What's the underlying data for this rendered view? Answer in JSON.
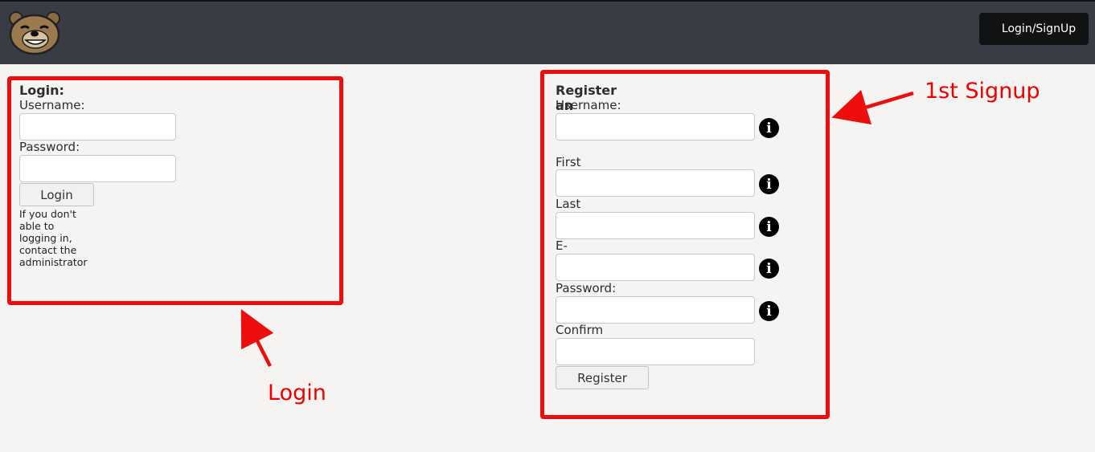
{
  "header": {
    "logo_icon": "bear-face-icon",
    "nav_button_label": "Login/SignUp"
  },
  "login": {
    "title": "Login:",
    "username_label": "Username:",
    "username_value": "",
    "password_label": "Password:",
    "password_value": "",
    "submit_label": "Login",
    "note": "If you don't able to logging in, contact the administrator"
  },
  "register": {
    "title": "Register an Account:",
    "fields": [
      {
        "label": "Username:",
        "value": "",
        "info_icon": "info-icon"
      },
      {
        "label": "First name(s):",
        "value": "",
        "info_icon": "info-icon"
      },
      {
        "label": "Last name(s):",
        "value": "",
        "info_icon": "info-icon"
      },
      {
        "label": "E-mail:",
        "value": "",
        "info_icon": "info-icon"
      },
      {
        "label": "Password:",
        "value": "",
        "info_icon": "info-icon"
      },
      {
        "label": "Confirm Password:",
        "value": ""
      }
    ],
    "submit_label": "Register"
  },
  "annotations": {
    "login_label": "Login",
    "signup_label": "1st Signup",
    "color": "#ee0d0d"
  },
  "colors": {
    "topbar": "#393c45",
    "page_background": "#f5f4f2",
    "nav_button": "#111214"
  }
}
